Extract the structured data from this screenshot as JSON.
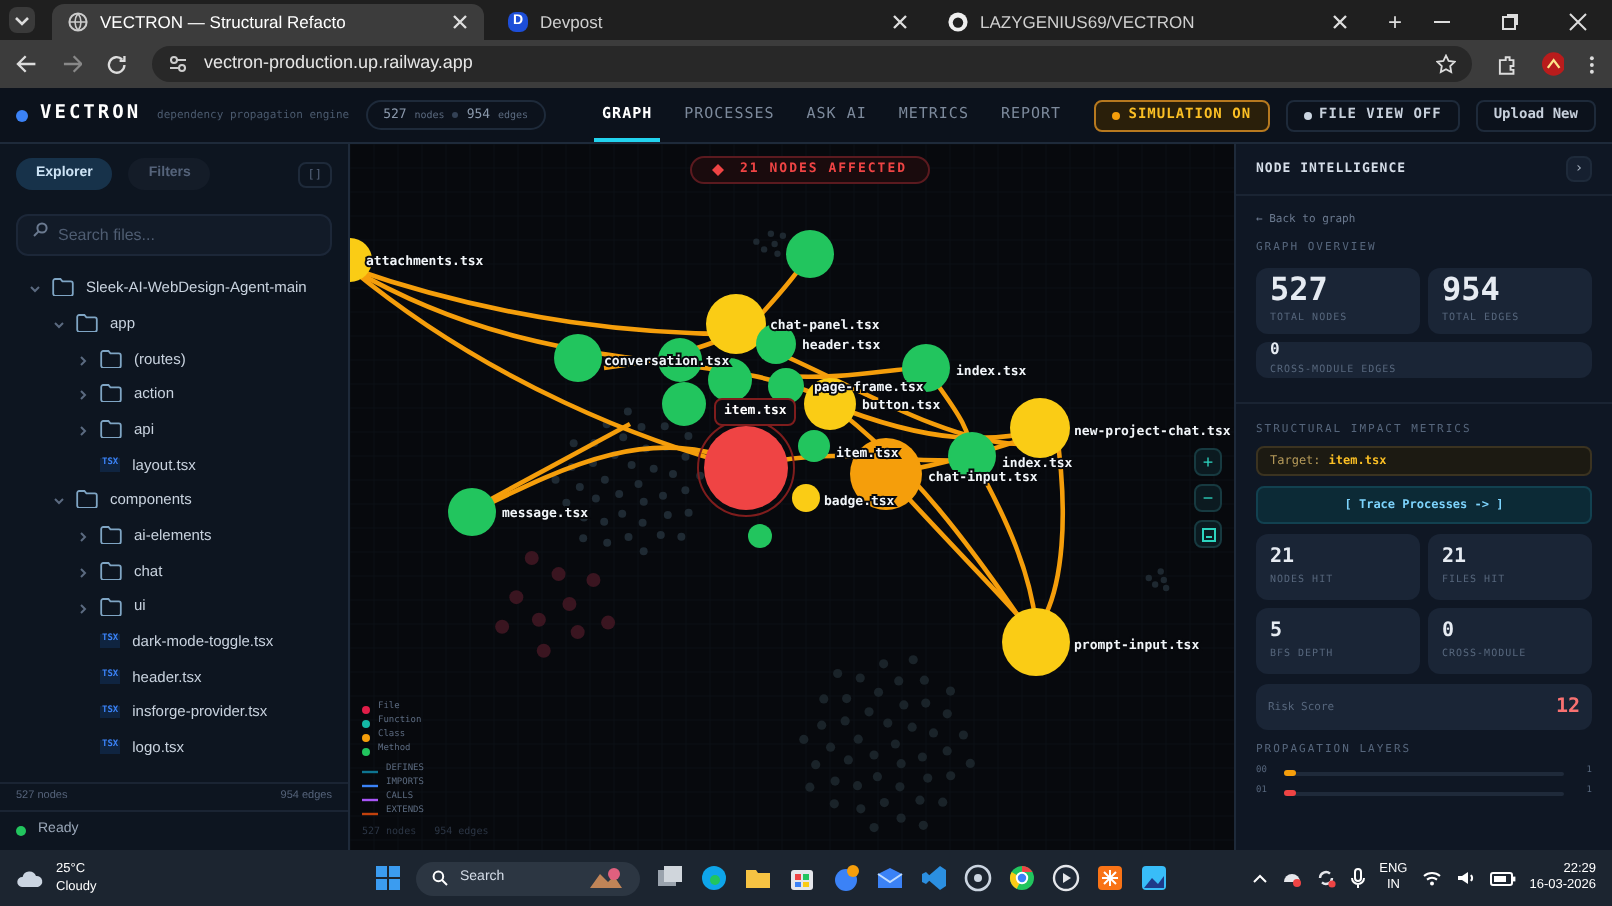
{
  "browser": {
    "tabs": [
      {
        "title": "VECTRON — Structural Refacto",
        "selected": true,
        "kind": "globe"
      },
      {
        "title": "Devpost",
        "selected": false,
        "kind": "letter",
        "letter": "D"
      },
      {
        "title": "LAZYGENIUS69/VECTRON",
        "selected": false,
        "kind": "octocat"
      }
    ],
    "new_tab": "+",
    "url": "vectron-production.up.railway.app"
  },
  "app_header": {
    "brand": "VECTRON",
    "tagline": "dependency propagation engine",
    "nodes": "527",
    "nodes_unit": "nodes",
    "edges": "954",
    "edges_unit": "edges",
    "nav": [
      {
        "label": "GRAPH",
        "selected": true
      },
      {
        "label": "PROCESSES",
        "selected": false
      },
      {
        "label": "ASK AI",
        "selected": false
      },
      {
        "label": "METRICS",
        "selected": false
      },
      {
        "label": "REPORT",
        "selected": false
      }
    ],
    "simulation": {
      "label": "SIMULATION ON",
      "on": true
    },
    "file_view": {
      "label": "FILE VIEW OFF",
      "on": false
    },
    "upload": "Upload New"
  },
  "sidebar": {
    "tabs": [
      {
        "label": "Explorer",
        "selected": true
      },
      {
        "label": "Filters",
        "selected": false
      }
    ],
    "toggle": "[]",
    "search": {
      "placeholder": "Search files..."
    },
    "tree": [
      {
        "kind": "folder",
        "name": "Sleek-AI-WebDesign-Agent-main",
        "expanded": true,
        "children": [
          {
            "kind": "folder",
            "name": "app",
            "expanded": true,
            "children": [
              {
                "kind": "folder",
                "name": "(routes)",
                "expanded": false
              },
              {
                "kind": "folder",
                "name": "action",
                "expanded": false
              },
              {
                "kind": "folder",
                "name": "api",
                "expanded": false
              },
              {
                "kind": "file",
                "badge": "TSX",
                "name": "layout.tsx"
              }
            ]
          },
          {
            "kind": "folder",
            "name": "components",
            "expanded": true,
            "children": [
              {
                "kind": "folder",
                "name": "ai-elements",
                "expanded": false
              },
              {
                "kind": "folder",
                "name": "chat",
                "expanded": false
              },
              {
                "kind": "folder",
                "name": "ui",
                "expanded": false
              },
              {
                "kind": "file",
                "badge": "TSX",
                "name": "dark-mode-toggle.tsx"
              },
              {
                "kind": "file",
                "badge": "TSX",
                "name": "header.tsx"
              },
              {
                "kind": "file",
                "badge": "TSX",
                "name": "insforge-provider.tsx"
              },
              {
                "kind": "file",
                "badge": "TSX",
                "name": "logo.tsx"
              }
            ]
          }
        ]
      }
    ],
    "footer": {
      "nodes": "527 nodes",
      "edges": "954 edges"
    },
    "status": "Ready"
  },
  "graph": {
    "banner": "21 NODES AFFECTED",
    "selected_label": "item.tsx",
    "nodes": [
      {
        "label": "attachments.tsx",
        "color": "#facc15"
      },
      {
        "label": "chat-panel.tsx",
        "color": "#facc15"
      },
      {
        "label": "header.tsx",
        "color": "#22c55e"
      },
      {
        "label": "conversation.tsx",
        "color": "#22c55e"
      },
      {
        "label": "page-frame.tsx",
        "color": "#22c55e"
      },
      {
        "label": "index.tsx",
        "color": "#22c55e"
      },
      {
        "label": "button.tsx",
        "color": "#facc15"
      },
      {
        "label": "new-project-chat.tsx",
        "color": "#facc15"
      },
      {
        "label": "item.tsx",
        "color": "#22c55e"
      },
      {
        "label": "badge.tsx",
        "color": "#facc15"
      },
      {
        "label": "chat-input.tsx",
        "color": "#f59e0b"
      },
      {
        "label": "index.tsx",
        "color": "#22c55e"
      },
      {
        "label": "message.tsx",
        "color": "#22c55e"
      },
      {
        "label": "prompt-input.tsx",
        "color": "#facc15"
      }
    ],
    "legend_nodes": [
      {
        "label": "File",
        "color": "#e11d48"
      },
      {
        "label": "Function",
        "color": "#14b8a6"
      },
      {
        "label": "Class",
        "color": "#f59e0b"
      },
      {
        "label": "Method",
        "color": "#22c55e"
      }
    ],
    "legend_edges": [
      {
        "label": "DEFINES",
        "color": "#0e7490"
      },
      {
        "label": "IMPORTS",
        "color": "#3b82f6"
      },
      {
        "label": "CALLS",
        "color": "#a855f7"
      },
      {
        "label": "EXTENDS",
        "color": "#c2410c"
      }
    ],
    "footer": "527 nodes   954 edges",
    "zoom_in": "+",
    "zoom_out": "−"
  },
  "panel": {
    "title": "NODE INTELLIGENCE",
    "collapse": "›",
    "back": "← Back to graph",
    "overview_heading": "GRAPH OVERVIEW",
    "overview": [
      {
        "value": "527",
        "label": "TOTAL NODES"
      },
      {
        "value": "954",
        "label": "TOTAL EDGES"
      },
      {
        "value": "0",
        "label": "CROSS-MODULE EDGES"
      }
    ],
    "impact_heading": "STRUCTURAL IMPACT METRICS",
    "target_label": "Target:",
    "target": "item.tsx",
    "trace": "[ Trace Processes -> ]",
    "metrics": [
      {
        "value": "21",
        "label": "NODES HIT"
      },
      {
        "value": "21",
        "label": "FILES HIT"
      },
      {
        "value": "5",
        "label": "BFS DEPTH"
      },
      {
        "value": "0",
        "label": "CROSS-MODULE"
      }
    ],
    "risk_label": "Risk Score",
    "risk": "12",
    "layers_heading": "PROPAGATION LAYERS",
    "layers": [
      {
        "label": "00",
        "level": 0.04,
        "count": "1",
        "color": "#f59e0b"
      },
      {
        "label": "01",
        "level": 0.04,
        "count": "1",
        "color": "#ef4444"
      }
    ]
  },
  "taskbar": {
    "temp": "25°C",
    "weather": "Cloudy",
    "search": "Search",
    "lang": "ENG",
    "region": "IN",
    "time": "22:29",
    "date": "16-03-2026"
  }
}
